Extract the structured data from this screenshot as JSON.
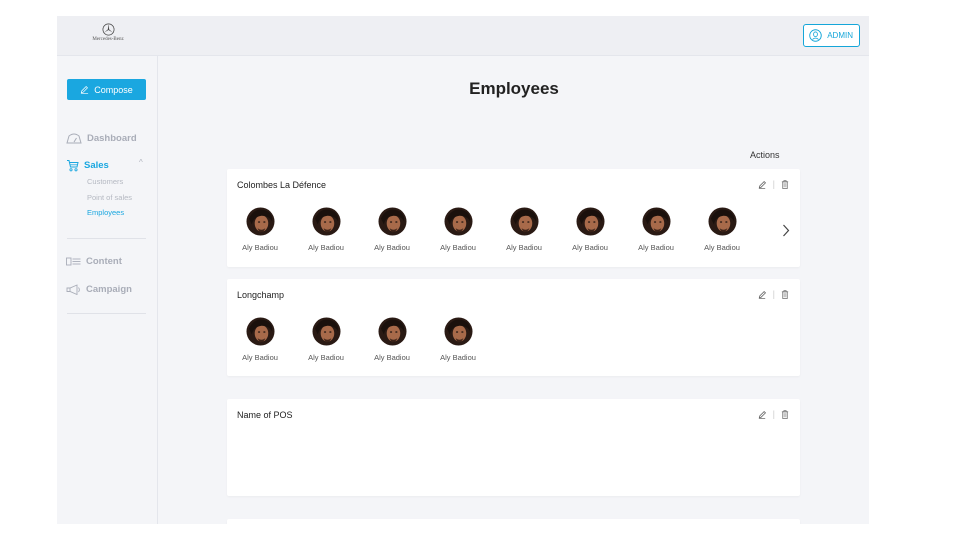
{
  "header": {
    "logo_text": "Mercedes-Benz",
    "admin_label": "ADMIN"
  },
  "sidebar": {
    "compose_label": "Compose",
    "items": [
      {
        "label": "Dashboard",
        "icon": "dashboard-icon"
      },
      {
        "label": "Sales",
        "icon": "cart-icon",
        "active": true,
        "children": [
          {
            "label": "Customers"
          },
          {
            "label": "Point of sales"
          },
          {
            "label": "Employees",
            "active": true
          }
        ]
      },
      {
        "label": "Content",
        "icon": "content-icon"
      },
      {
        "label": "Campaign",
        "icon": "megaphone-icon"
      }
    ]
  },
  "main": {
    "title": "Employees",
    "actions_label": "Actions",
    "cards": [
      {
        "title": "Colombes La Défence",
        "employees": [
          "Aly Badiou",
          "Aly Badiou",
          "Aly Badiou",
          "Aly Badiou",
          "Aly Badiou",
          "Aly Badiou",
          "Aly Badiou",
          "Aly Badiou"
        ],
        "has_next": true
      },
      {
        "title": "Longchamp",
        "employees": [
          "Aly Badiou",
          "Aly Badiou",
          "Aly Badiou",
          "Aly Badiou"
        ]
      },
      {
        "title": "Name of POS",
        "employees": []
      }
    ]
  },
  "colors": {
    "accent": "#1aa7e0",
    "muted": "#a9adb8",
    "background": "#f4f5f8"
  }
}
